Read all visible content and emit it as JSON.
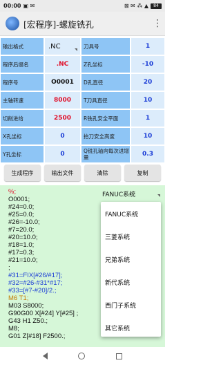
{
  "status_bar": {
    "time": "00:00",
    "left_icons": "▣ ✉",
    "right_icons": "⊠ ✉ ⁂ ▲",
    "battery": "84"
  },
  "app_bar": {
    "title": "[宏程序]-螺旋铣孔",
    "menu_icon": "⋮"
  },
  "form": {
    "rows": [
      {
        "l1": "输出格式",
        "v1": ".NC",
        "l2": "刀具号",
        "v2": "1"
      },
      {
        "l1": "程序后缀名",
        "v1": ".NC",
        "l2": "Z孔坐标",
        "v2": "-10"
      },
      {
        "l1": "程序号",
        "v1": "O0001",
        "l2": "D孔直径",
        "v2": "20"
      },
      {
        "l1": "主轴转速",
        "v1": "8000",
        "l2": "T刀具直径",
        "v2": "10"
      },
      {
        "l1": "切削进给",
        "v1": "2500",
        "l2": "R铣孔安全平面",
        "v2": "1"
      },
      {
        "l1": "X孔坐标",
        "v1": "0",
        "l2": "抬刀安全高度",
        "v2": "10"
      },
      {
        "l1": "Y孔坐标",
        "v1": "0",
        "l2": "Q铣孔轴向每次进增量",
        "v2": "0.3"
      }
    ]
  },
  "buttons": {
    "generate": "生成程序",
    "export": "输出文件",
    "clear": "清除",
    "copy": "复制"
  },
  "system_select": {
    "selected": "FANUC系统",
    "options": [
      "FANUC系统",
      "三菱系统",
      "兄弟系统",
      "新代系统",
      "西门子系统",
      "其它系统"
    ]
  },
  "code": {
    "lines": [
      {
        "text": "%;",
        "color": "#e0102a"
      },
      {
        "text": "O0001;",
        "color": "#111111"
      },
      {
        "text": "#24=0.0;",
        "color": "#111111"
      },
      {
        "text": "#25=0.0;",
        "color": "#111111"
      },
      {
        "text": "#26=-10.0;",
        "color": "#111111"
      },
      {
        "text": "#7=20.0;",
        "color": "#111111"
      },
      {
        "text": "#20=10.0;",
        "color": "#111111"
      },
      {
        "text": "#18=1.0;",
        "color": "#111111"
      },
      {
        "text": "#17=0.3;",
        "color": "#111111"
      },
      {
        "text": "#21=10.0;",
        "color": "#111111"
      },
      {
        "text": ";",
        "color": "#111111"
      },
      {
        "text": "#31=FIX[#26/#17];",
        "color": "#1a3cd6"
      },
      {
        "text": "#32=#26-#31*#17;",
        "color": "#1a3cd6"
      },
      {
        "text": "#33=[#7-#20]/2.;",
        "color": "#1a3cd6"
      },
      {
        "text": "M6 T1;",
        "color": "#c47a00"
      },
      {
        "text": "M03 S8000;",
        "color": "#111111"
      },
      {
        "text": "G90G00 X[#24] Y[#25] ;",
        "color": "#111111"
      },
      {
        "text": "G43 H1 Z50.;",
        "color": "#111111"
      },
      {
        "text": "M8;",
        "color": "#111111"
      },
      {
        "text": "G01 Z[#18] F2500.;",
        "color": "#111111"
      }
    ]
  },
  "nav": {
    "back_icon": "back",
    "home_icon": "home",
    "recent_icon": "recent"
  }
}
